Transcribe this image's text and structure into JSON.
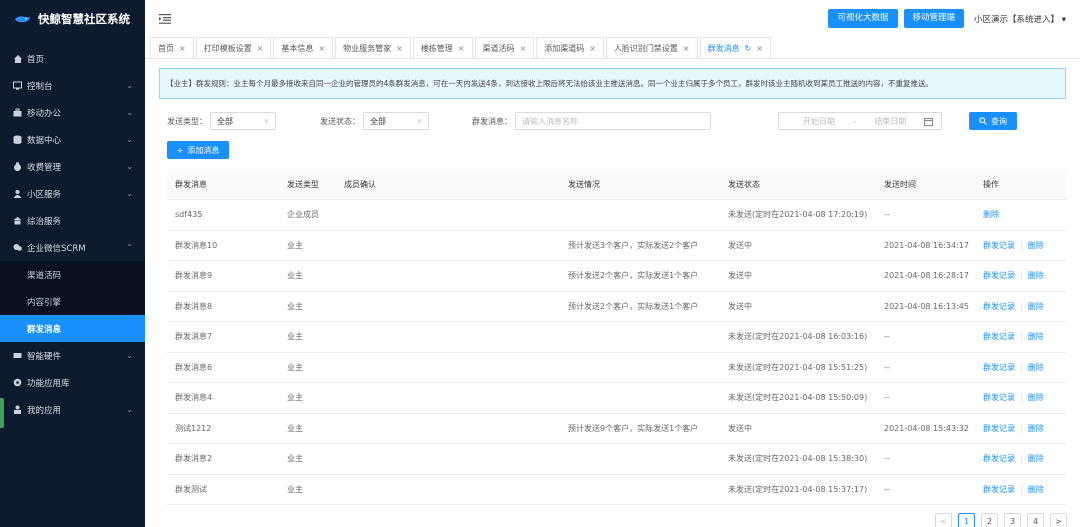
{
  "app": {
    "title": "快鲸智慧社区系统"
  },
  "sidebar": {
    "items": [
      {
        "label": "首页",
        "icon": "home-icon",
        "chevron": ""
      },
      {
        "label": "控制台",
        "icon": "console-icon",
        "chevron": "⌄"
      },
      {
        "label": "移动办公",
        "icon": "briefcase-icon",
        "chevron": "⌄"
      },
      {
        "label": "数据中心",
        "icon": "database-icon",
        "chevron": "⌄"
      },
      {
        "label": "收费管理",
        "icon": "money-bag-icon",
        "chevron": "⌄"
      },
      {
        "label": "小区服务",
        "icon": "service-icon",
        "chevron": "⌄"
      },
      {
        "label": "综治服务",
        "icon": "building-icon",
        "chevron": ""
      },
      {
        "label": "企业微信SCRM",
        "icon": "chat-icon",
        "chevron": "⌃"
      }
    ],
    "subitems": [
      {
        "label": "渠道活码"
      },
      {
        "label": "内容引擎"
      },
      {
        "label": "群发消息"
      }
    ],
    "items_after": [
      {
        "label": "智能硬件",
        "icon": "hardware-icon",
        "chevron": "⌄"
      },
      {
        "label": "功能应用库",
        "icon": "app-library-icon",
        "chevron": ""
      },
      {
        "label": "我的应用",
        "icon": "user-icon",
        "chevron": "⌄"
      }
    ]
  },
  "header": {
    "btn_bigdata": "可视化大数据",
    "btn_mobile": "移动管理端",
    "user": "小区演示【系统进入】 ▾"
  },
  "tabs": [
    {
      "label": "首页"
    },
    {
      "label": "打印模板设置"
    },
    {
      "label": "基本信息"
    },
    {
      "label": "物业服务管家"
    },
    {
      "label": "楼栋管理"
    },
    {
      "label": "渠道活码"
    },
    {
      "label": "添加渠道码"
    },
    {
      "label": "人脸识别门禁设置"
    },
    {
      "label": "群发消息"
    }
  ],
  "notice": "【业主】群发规则：业主每个月最多接收来自同一企业的管理员的4条群发消息，可在一天内发送4条，到达接收上限后将无法给该业主推送消息。同一个业主归属于多个员工，群发时该业主随机收到某员工推送的内容，不重复推送。",
  "filters": {
    "type_label": "发送类型：",
    "type_value": "全部",
    "status_label": "发送状态：",
    "status_value": "全部",
    "msg_label": "群发消息：",
    "msg_placeholder": "请输入消息名称",
    "date_start": "开始日期",
    "date_sep": "–",
    "date_end": "结束日期",
    "search_btn": "查询"
  },
  "add_btn": "添加消息",
  "table": {
    "headers": [
      "群发消息",
      "发送类型",
      "成员确认",
      "发送情况",
      "发送状态",
      "发送时间",
      "操作"
    ],
    "rows": [
      {
        "msg": "sdf435",
        "type": "企业成员",
        "confirm": "",
        "situation": "",
        "status": "未发送(定时在2021-04-08 17:20:19)",
        "time": "--",
        "record": "",
        "delete": "删除"
      },
      {
        "msg": "群发消息10",
        "type": "业主",
        "confirm": "",
        "situation": "预计发送3个客户，实际发送2个客户",
        "status": "发送中",
        "time": "2021-04-08 16:34:17",
        "record": "群发记录",
        "delete": "删除"
      },
      {
        "msg": "群发消息9",
        "type": "业主",
        "confirm": "",
        "situation": "预计发送2个客户，实际发送1个客户",
        "status": "发送中",
        "time": "2021-04-08 16:28:17",
        "record": "群发记录",
        "delete": "删除"
      },
      {
        "msg": "群发消息8",
        "type": "业主",
        "confirm": "",
        "situation": "预计发送2个客户，实际发送1个客户",
        "status": "发送中",
        "time": "2021-04-08 16:13:45",
        "record": "群发记录",
        "delete": "删除"
      },
      {
        "msg": "群发消息7",
        "type": "业主",
        "confirm": "",
        "situation": "",
        "status": "未发送(定时在2021-04-08 16:03:16)",
        "time": "--",
        "record": "群发记录",
        "delete": "删除"
      },
      {
        "msg": "群发消息6",
        "type": "业主",
        "confirm": "",
        "situation": "",
        "status": "未发送(定时在2021-04-08 15:51:25)",
        "time": "--",
        "record": "群发记录",
        "delete": "删除"
      },
      {
        "msg": "群发消息4",
        "type": "业主",
        "confirm": "",
        "situation": "",
        "status": "未发送(定时在2021-04-08 15:50:09)",
        "time": "--",
        "record": "群发记录",
        "delete": "删除"
      },
      {
        "msg": "测试1212",
        "type": "业主",
        "confirm": "",
        "situation": "预计发送9个客户，实际发送1个客户",
        "status": "发送中",
        "time": "2021-04-08 15:43:32",
        "record": "群发记录",
        "delete": "删除"
      },
      {
        "msg": "群发消息2",
        "type": "业主",
        "confirm": "",
        "situation": "",
        "status": "未发送(定时在2021-04-08 15:38:30)",
        "time": "--",
        "record": "群发记录",
        "delete": "删除"
      },
      {
        "msg": "群发测试",
        "type": "业主",
        "confirm": "",
        "situation": "",
        "status": "未发送(定时在2021-04-08 15:37:17)",
        "time": "--",
        "record": "群发记录",
        "delete": "删除"
      }
    ]
  },
  "pagination": {
    "prev": "<",
    "pages": [
      "1",
      "2",
      "3",
      "4"
    ],
    "current": "1",
    "next": ">"
  },
  "colors": {
    "sidebar_bg": "#0d1b2e",
    "accent": "#1890ff",
    "notice_bg": "#e6f7ff"
  }
}
